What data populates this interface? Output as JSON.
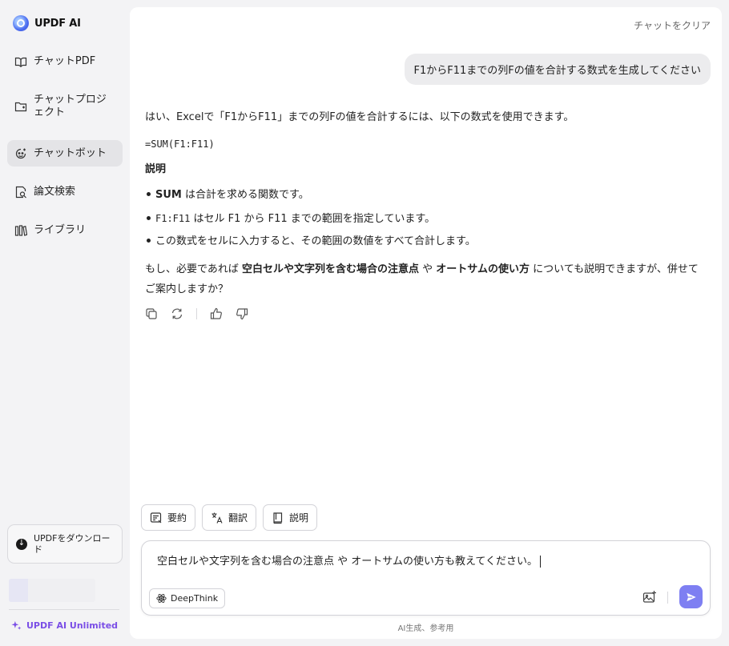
{
  "app": {
    "name": "UPDF AI"
  },
  "sidebar": {
    "items": [
      {
        "label": "チャットPDF",
        "icon": "book-icon",
        "active": false
      },
      {
        "label": "チャットプロジェクト",
        "icon": "folder-icon",
        "active": false
      },
      {
        "label": "チャットボット",
        "icon": "bot-icon",
        "active": true
      },
      {
        "label": "論文検索",
        "icon": "search-doc-icon",
        "active": false
      },
      {
        "label": "ライブラリ",
        "icon": "library-icon",
        "active": false
      }
    ],
    "download_label": "UPDFをダウンロード",
    "unlimited_label": "UPDF AI Unlimited"
  },
  "header": {
    "clear_label": "チャットをクリア"
  },
  "chat": {
    "user_message": "F1からF11までの列Fの値を合計する数式を生成してください",
    "answer": {
      "intro": "はい、Excelで「F1からF11」までの列Fの値を合計するには、以下の数式を使用できます。",
      "formula": "=SUM(F1:F11)",
      "heading": "説明",
      "b1_bold": "SUM",
      "b1_rest": " は合計を求める関数です。",
      "b2_mono": "F1:F11",
      "b2_rest": " はセル F1 から F11 までの範囲を指定しています。",
      "b3": "この数式をセルに入力すると、その範囲の数値をすべて合計します。",
      "outro_1": "もし、必要であれば ",
      "outro_bold_1": "空白セルや文字列を含む場合の注意点",
      "outro_2": " や ",
      "outro_bold_2": "オートサムの使い方",
      "outro_3": " についても説明できますが、併せてご案内しますか？"
    }
  },
  "quick_actions": {
    "summary": "要約",
    "translate": "翻訳",
    "explain": "説明"
  },
  "composer": {
    "text": "空白セルや文字列を含む場合の注意点 や オートサムの使い方も教えてください。",
    "deepthink_label": "DeepThink"
  },
  "footer": {
    "note": "AI生成、参考用"
  },
  "colors": {
    "accent": "#7e7ff2",
    "brand_purple": "#7a4ee6",
    "active_bg": "#e4e4e7"
  }
}
